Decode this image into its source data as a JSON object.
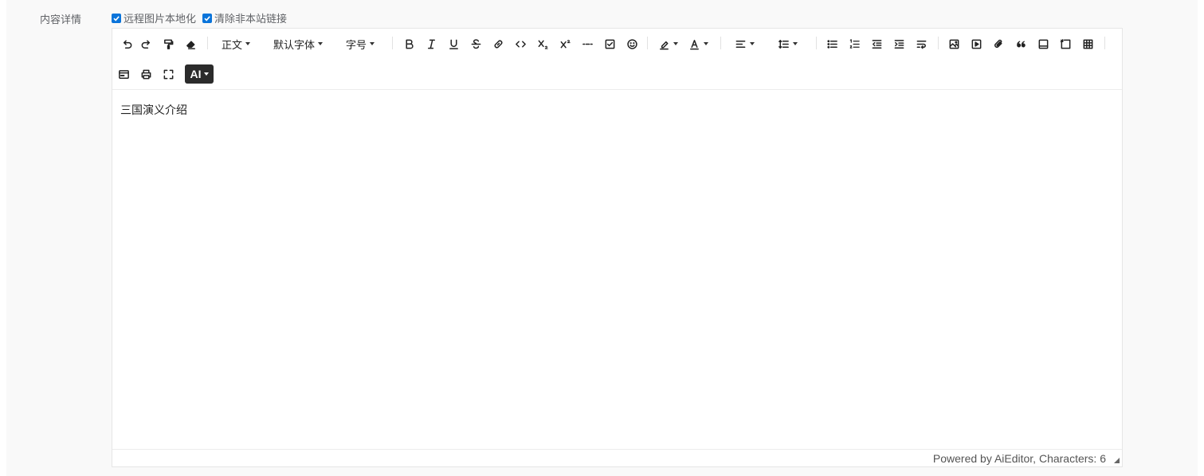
{
  "field": {
    "label": "内容详情"
  },
  "options": [
    {
      "label": "远程图片本地化",
      "checked": true
    },
    {
      "label": "清除非本站链接",
      "checked": true
    }
  ],
  "toolbar": {
    "heading_label": "正文",
    "font_label": "默认字体",
    "size_label": "字号",
    "ai_label": "AI"
  },
  "content": {
    "text": "三国演义介绍"
  },
  "footer": {
    "status": "Powered by AiEditor, Characters: 6"
  },
  "colors": {
    "accent": "#0a74da",
    "ai_button": "#2b2b2b"
  }
}
